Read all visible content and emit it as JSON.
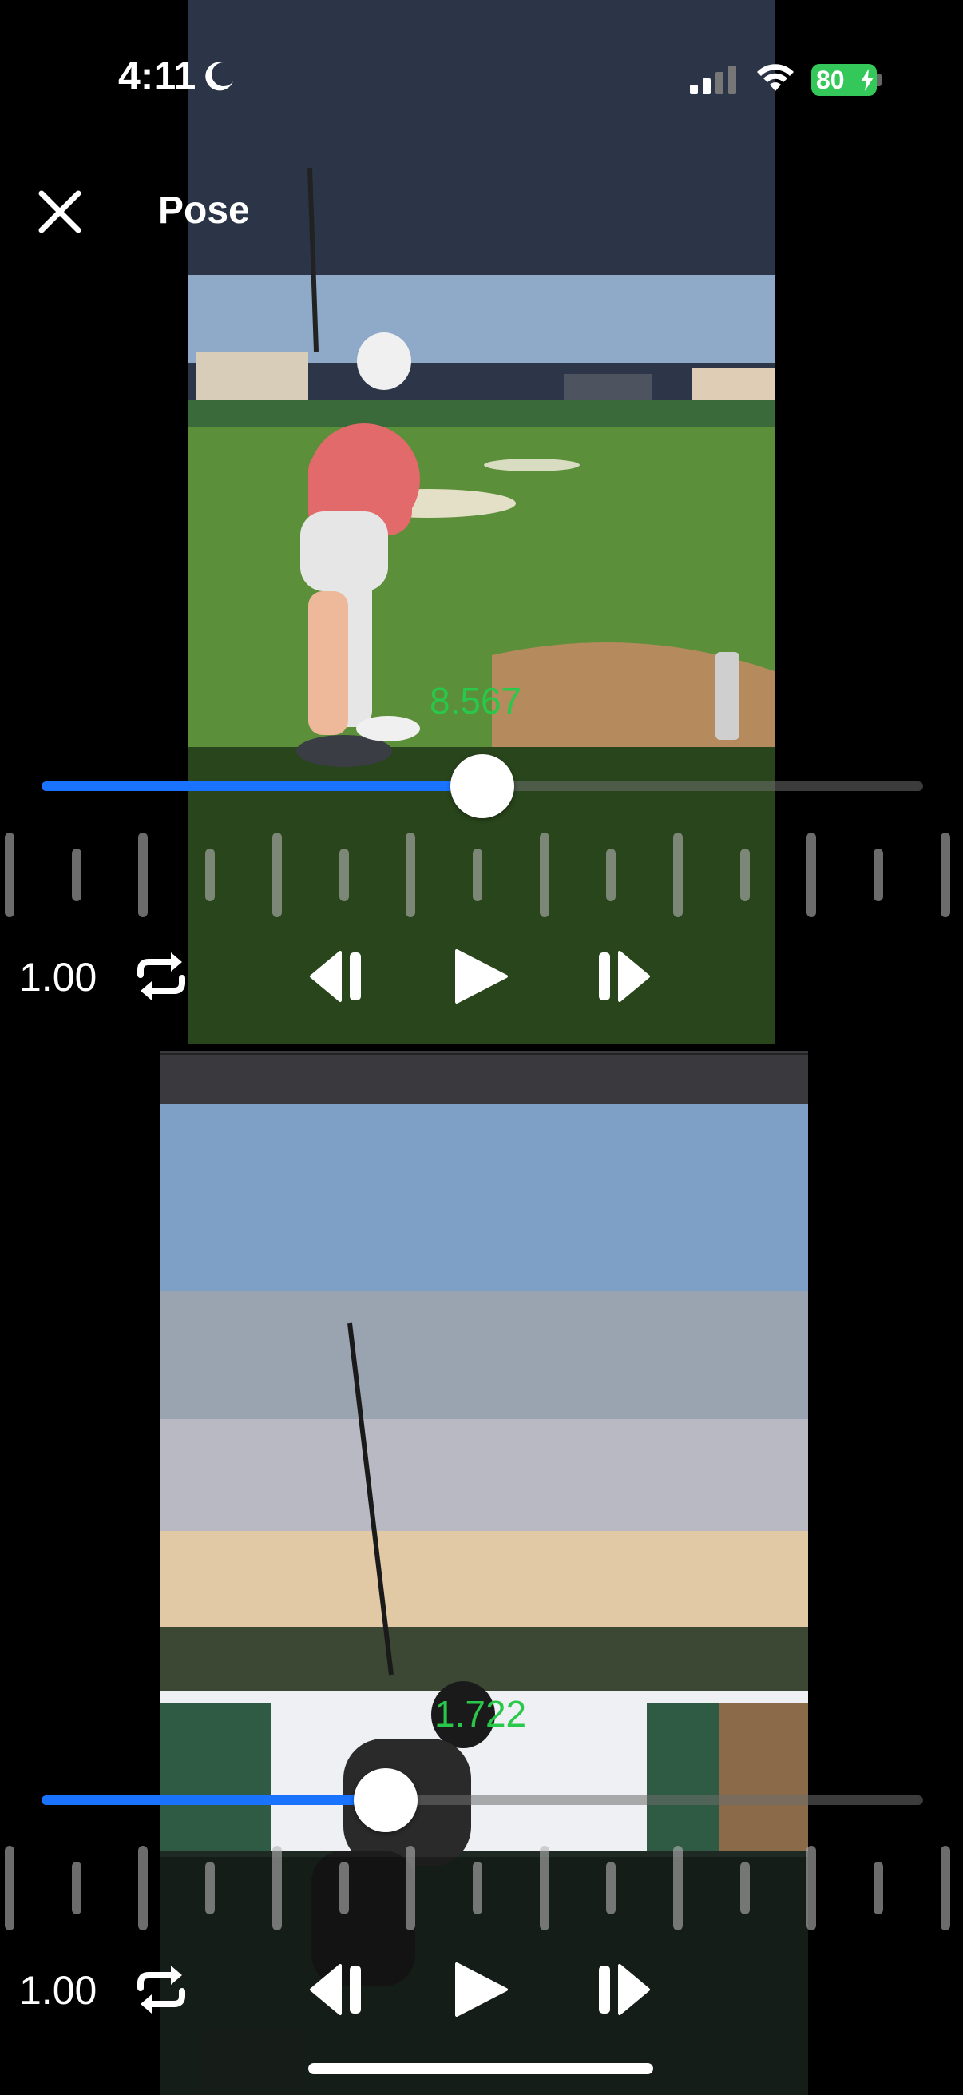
{
  "status_bar": {
    "time": "4:11",
    "battery": "80",
    "icons": [
      "moon-icon",
      "signal-icon",
      "wifi-icon",
      "battery-icon"
    ]
  },
  "header": {
    "title": "Pose",
    "close_icon": "close-icon"
  },
  "players": [
    {
      "readout": "8.567",
      "progress": 0.5,
      "speed": "1.00",
      "controls": [
        "loop-icon",
        "step-back-icon",
        "play-icon",
        "step-forward-icon"
      ]
    },
    {
      "readout": "1.722",
      "progress": 0.39,
      "speed": "1.00",
      "controls": [
        "loop-icon",
        "step-back-icon",
        "play-icon",
        "step-forward-icon"
      ]
    }
  ],
  "colors": {
    "accent": "#1a73ff",
    "readout": "#29c74a",
    "battery": "#34c759"
  }
}
